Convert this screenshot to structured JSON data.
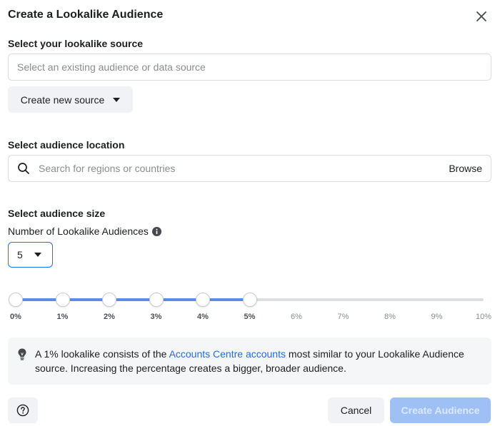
{
  "dialog": {
    "title": "Create a Lookalike Audience",
    "close_icon": "close-icon"
  },
  "source": {
    "label": "Select your lookalike source",
    "placeholder": "Select an existing audience or data source",
    "value": "",
    "create_button_label": "Create new source"
  },
  "location": {
    "label": "Select audience location",
    "placeholder": "Search for regions or countries",
    "value": "",
    "browse_label": "Browse"
  },
  "size": {
    "label": "Select audience size",
    "count_label": "Number of Lookalike Audiences",
    "count_value": "5",
    "slider": {
      "min_percent": 0,
      "max_percent": 10,
      "selected_points_percent": [
        0,
        1,
        2,
        3,
        4,
        5
      ],
      "ticks": [
        "0%",
        "1%",
        "2%",
        "3%",
        "4%",
        "5%",
        "6%",
        "7%",
        "8%",
        "9%",
        "10%"
      ],
      "active_color": "#5b8cea",
      "inactive_color": "#dadde1"
    }
  },
  "info": {
    "text_before": "A 1% lookalike consists of the ",
    "link_text": "Accounts Centre accounts",
    "text_after": " most similar to your Lookalike Audience source. Increasing the percentage creates a bigger, broader audience."
  },
  "footer": {
    "help_icon": "help-icon",
    "cancel_label": "Cancel",
    "create_label": "Create Audience",
    "create_color": "#9ec0f5"
  }
}
